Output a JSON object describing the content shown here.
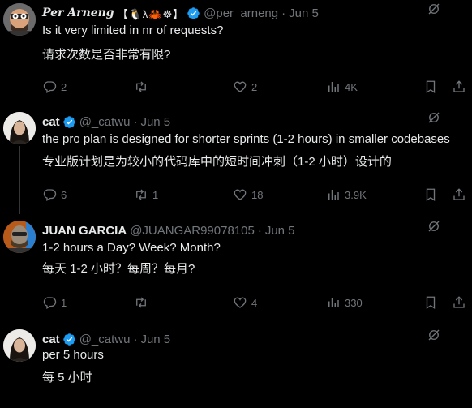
{
  "replies": [
    {
      "name": "Per Arneng",
      "badges": "【🐧λ🦀☸】",
      "handle": "@per_arneng",
      "date": "Jun 5",
      "text_lines": [
        "Is it very limited in nr of requests?",
        "请求次数是否非常有限?"
      ],
      "stats": {
        "replies": "2",
        "reposts": "",
        "likes": "2",
        "views": "4K"
      }
    },
    {
      "name": "cat",
      "handle": "@_catwu",
      "date": "Jun 5",
      "text_lines": [
        "the pro plan is designed for shorter sprints (1-2 hours) in smaller codebases",
        "专业版计划是为较小的代码库中的短时间冲刺（1-2 小时）设计的"
      ],
      "stats": {
        "replies": "6",
        "reposts": "1",
        "likes": "18",
        "views": "3.9K"
      }
    },
    {
      "name": "JUAN GARCIA",
      "handle": "@JUANGAR99078105",
      "date": "Jun 5",
      "text_lines": [
        "1-2 hours a Day? Week? Month?",
        "每天 1-2 小时？每周？每月?"
      ],
      "stats": {
        "replies": "1",
        "reposts": "",
        "likes": "4",
        "views": "330"
      }
    },
    {
      "name": "cat",
      "handle": "@_catwu",
      "date": "Jun 5",
      "text_lines": [
        "per 5 hours",
        "每 5 小时"
      ],
      "stats": {
        "replies": "",
        "reposts": "",
        "likes": "",
        "views": ""
      }
    }
  ],
  "separator": "·",
  "icons": {
    "verified": "verified-badge-icon",
    "more": "grok-slash-icon",
    "reply": "reply-bubble-icon",
    "repost": "repost-arrows-icon",
    "like": "heart-icon",
    "views": "views-bars-icon",
    "bookmark": "bookmark-icon",
    "share": "share-upload-icon"
  },
  "colors": {
    "background": "#000000",
    "text": "#e7e9ea",
    "muted": "#71767b",
    "verified": "#1d9bf0",
    "thread_line": "#333639"
  }
}
